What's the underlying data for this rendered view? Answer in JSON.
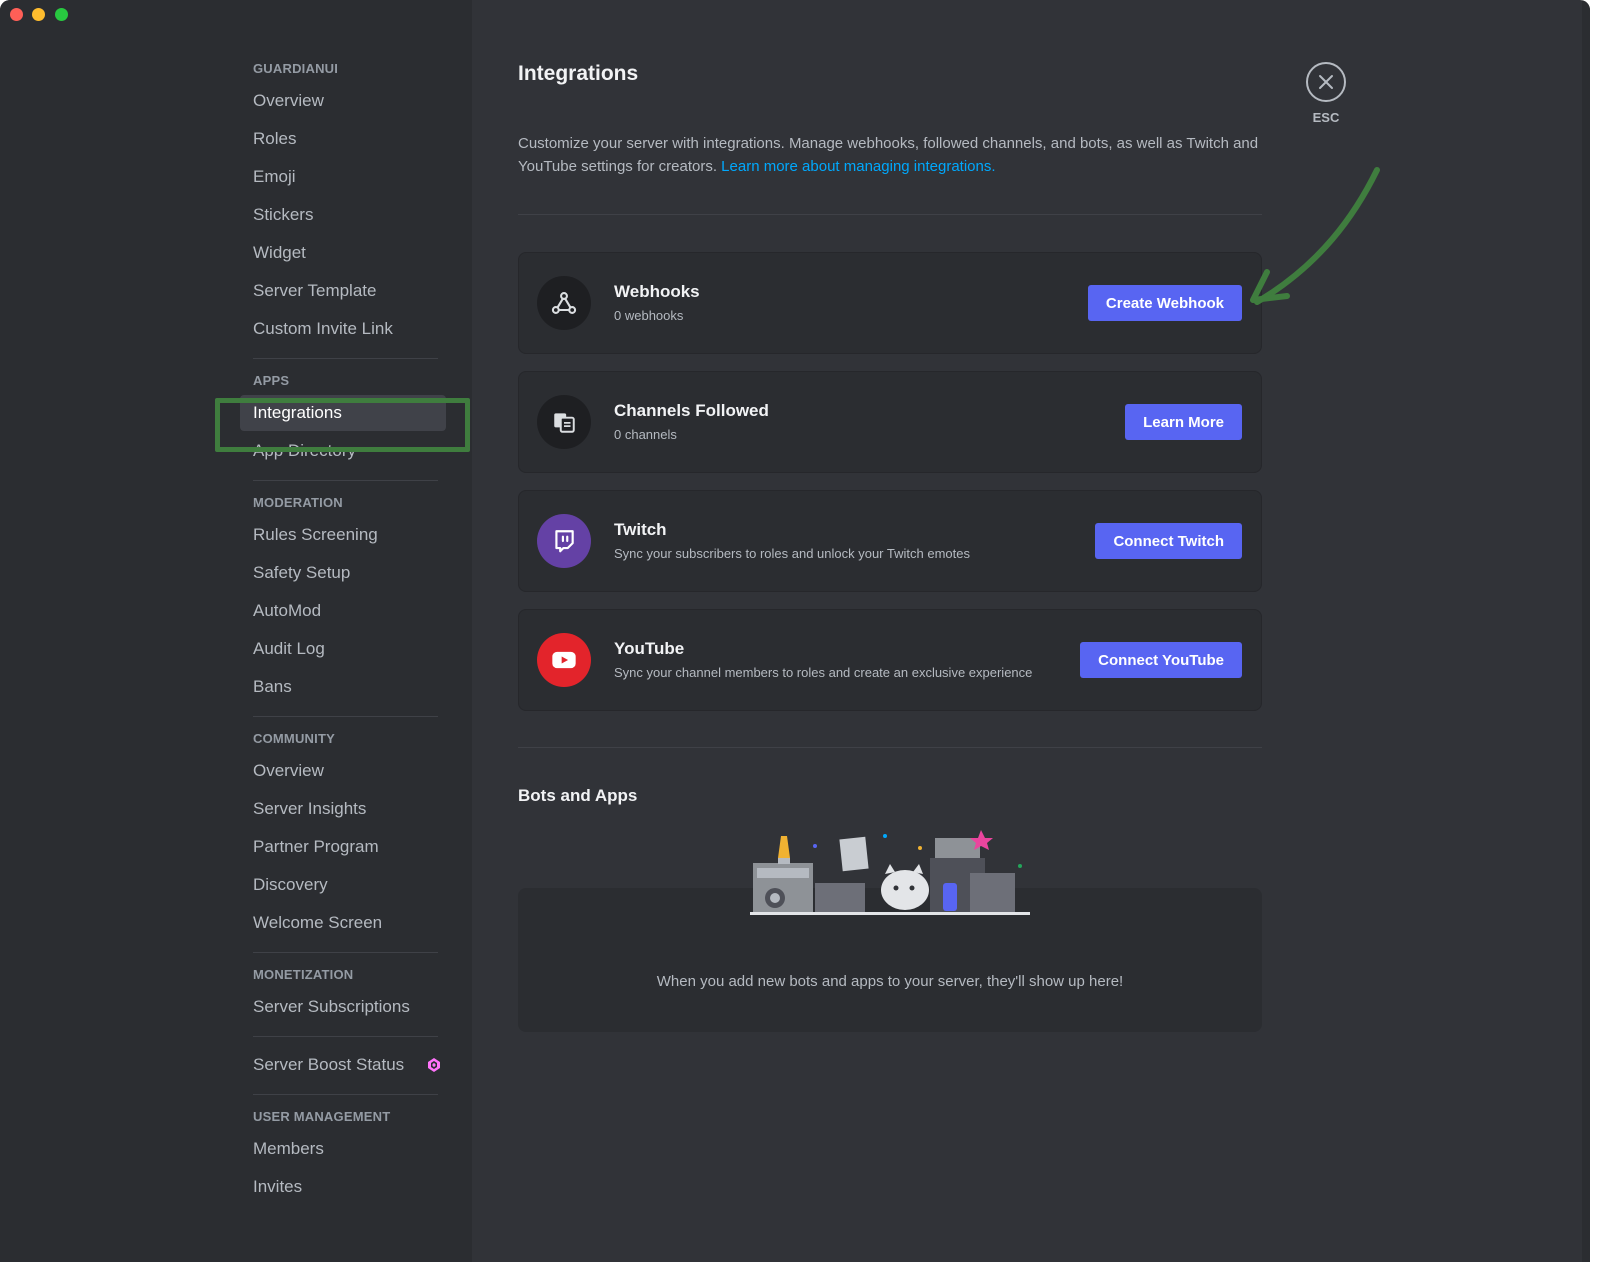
{
  "sidebar": {
    "sections": [
      {
        "header": "GUARDIANUI",
        "items": [
          "Overview",
          "Roles",
          "Emoji",
          "Stickers",
          "Widget",
          "Server Template",
          "Custom Invite Link"
        ]
      },
      {
        "header": "APPS",
        "items": [
          "Integrations",
          "App Directory"
        ]
      },
      {
        "header": "MODERATION",
        "items": [
          "Rules Screening",
          "Safety Setup",
          "AutoMod",
          "Audit Log",
          "Bans"
        ]
      },
      {
        "header": "COMMUNITY",
        "items": [
          "Overview",
          "Server Insights",
          "Partner Program",
          "Discovery",
          "Welcome Screen"
        ]
      },
      {
        "header": "MONETIZATION",
        "items": [
          "Server Subscriptions"
        ]
      },
      {
        "header": "",
        "items": [
          "Server Boost Status"
        ]
      },
      {
        "header": "USER MANAGEMENT",
        "items": [
          "Members",
          "Invites"
        ]
      }
    ],
    "active_item": "Integrations",
    "boost_icon": "boost-gem-icon"
  },
  "main": {
    "title": "Integrations",
    "description": "Customize your server with integrations. Manage webhooks, followed channels, and bots, as well as Twitch and YouTube settings for creators.",
    "learn_more_link": "Learn more about managing integrations.",
    "cards": [
      {
        "title": "Webhooks",
        "subtitle": "0 webhooks",
        "button": "Create Webhook",
        "icon": "webhook-icon"
      },
      {
        "title": "Channels Followed",
        "subtitle": "0 channels",
        "button": "Learn More",
        "icon": "channels-followed-icon"
      },
      {
        "title": "Twitch",
        "subtitle": "Sync your subscribers to roles and unlock your Twitch emotes",
        "button": "Connect Twitch",
        "icon": "twitch-icon"
      },
      {
        "title": "YouTube",
        "subtitle": "Sync your channel members to roles and create an exclusive experience",
        "button": "Connect YouTube",
        "icon": "youtube-icon"
      }
    ],
    "bots_title": "Bots and Apps",
    "bots_empty_text": "When you add new bots and apps to your server, they'll show up here!"
  },
  "close": {
    "label": "ESC"
  },
  "colors": {
    "accent": "#5865f2",
    "link": "#00a8fc",
    "annotation_green": "#3f7d3e",
    "twitch": "#6441a5",
    "youtube": "#e3242b"
  }
}
